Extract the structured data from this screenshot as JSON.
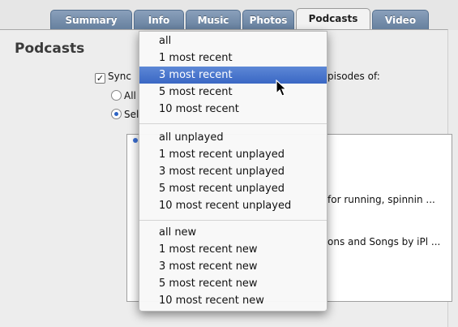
{
  "tabs": [
    {
      "label": "Summary"
    },
    {
      "label": "Info"
    },
    {
      "label": "Music"
    },
    {
      "label": "Photos"
    },
    {
      "label": "Podcasts"
    },
    {
      "label": "Video"
    }
  ],
  "active_tab": "Podcasts",
  "page_title": "Podcasts",
  "sync": {
    "checkbox_label": "Sync",
    "checkbox_checked": true,
    "label_end": "pisodes of:"
  },
  "radio": {
    "all_label": "All",
    "selected_label": "Sel"
  },
  "list_items": [
    {
      "text": "for running, spinnin ..."
    },
    {
      "text": "ons and Songs by iPl ..."
    }
  ],
  "menu": {
    "group1": [
      "all",
      "1 most recent",
      "3 most recent",
      "5 most recent",
      "10 most recent"
    ],
    "group2": [
      "all unplayed",
      "1 most recent unplayed",
      "3 most recent unplayed",
      "5 most recent unplayed",
      "10 most recent unplayed"
    ],
    "group3": [
      "all new",
      "1 most recent new",
      "3 most recent new",
      "5 most recent new",
      "10 most recent new"
    ],
    "selected": "3 most recent"
  },
  "colors": {
    "tab_bg": "#7890ad",
    "selection": "#3a67c4"
  }
}
